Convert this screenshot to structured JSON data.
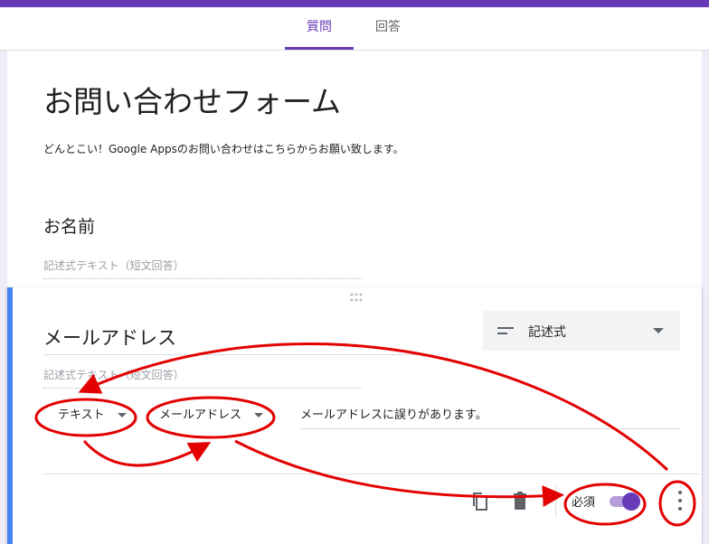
{
  "tabs": {
    "questions": "質問",
    "responses": "回答"
  },
  "form": {
    "title": "お問い合わせフォーム",
    "description": "どんとこい！Google Appsのお問い合わせはこちらからお願い致します。"
  },
  "questions": [
    {
      "title": "お名前",
      "answer_placeholder": "記述式テキスト（短文回答）"
    },
    {
      "title": "メールアドレス",
      "answer_placeholder": "記述式テキスト（短文回答）",
      "type_label": "記述式",
      "validation": {
        "type": "テキスト",
        "condition": "メールアドレス",
        "error_text": "メールアドレスに誤りがあります。"
      },
      "required_label": "必須",
      "required": true
    }
  ],
  "icons": {
    "type": "short-answer-icon",
    "copy": "copy-icon",
    "delete": "trash-icon",
    "more": "more-vert-icon",
    "drag": "drag-handle-icon"
  },
  "colors": {
    "accent": "#673ab7",
    "active_border": "#4285f4",
    "annotation": "#e30000"
  }
}
